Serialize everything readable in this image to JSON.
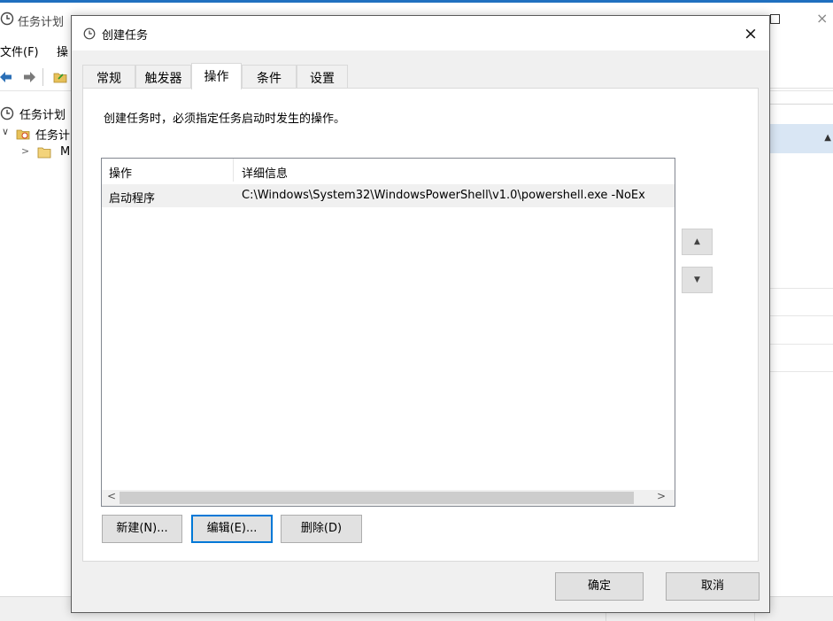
{
  "background_window": {
    "title": "任务计划",
    "menu": [
      "文件(F)",
      "操"
    ],
    "tree": {
      "root": "任务计划",
      "library": "任务计",
      "child": "M"
    }
  },
  "dialog": {
    "title": "创建任务",
    "close_glyph": "×",
    "tabs": [
      {
        "label": "常规",
        "active": false
      },
      {
        "label": "触发器",
        "active": false
      },
      {
        "label": "操作",
        "active": true
      },
      {
        "label": "条件",
        "active": false
      },
      {
        "label": "设置",
        "active": false
      }
    ],
    "description": "创建任务时，必须指定任务启动时发生的操作。",
    "list": {
      "columns": [
        "操作",
        "详细信息"
      ],
      "rows": [
        {
          "action": "启动程序",
          "details": "C:\\Windows\\System32\\WindowsPowerShell\\v1.0\\powershell.exe -NoEx"
        }
      ]
    },
    "move_up_glyph": "▲",
    "move_down_glyph": "▼",
    "scroll_left_glyph": "<",
    "scroll_right_glyph": ">",
    "buttons": {
      "new": "新建(N)...",
      "edit": "编辑(E)...",
      "delete": "删除(D)"
    },
    "footer": {
      "ok": "确定",
      "cancel": "取消"
    }
  },
  "colors": {
    "accent_focus": "#0078d7",
    "dialog_bg": "#f0f0f0",
    "selected_row_bg": "#f0f0f0",
    "tree_selected_bg": "#d9e6f4"
  },
  "icons": [
    "clock-icon",
    "back-arrow-icon",
    "forward-arrow-icon",
    "folder-icon",
    "calendar-folder-icon"
  ]
}
